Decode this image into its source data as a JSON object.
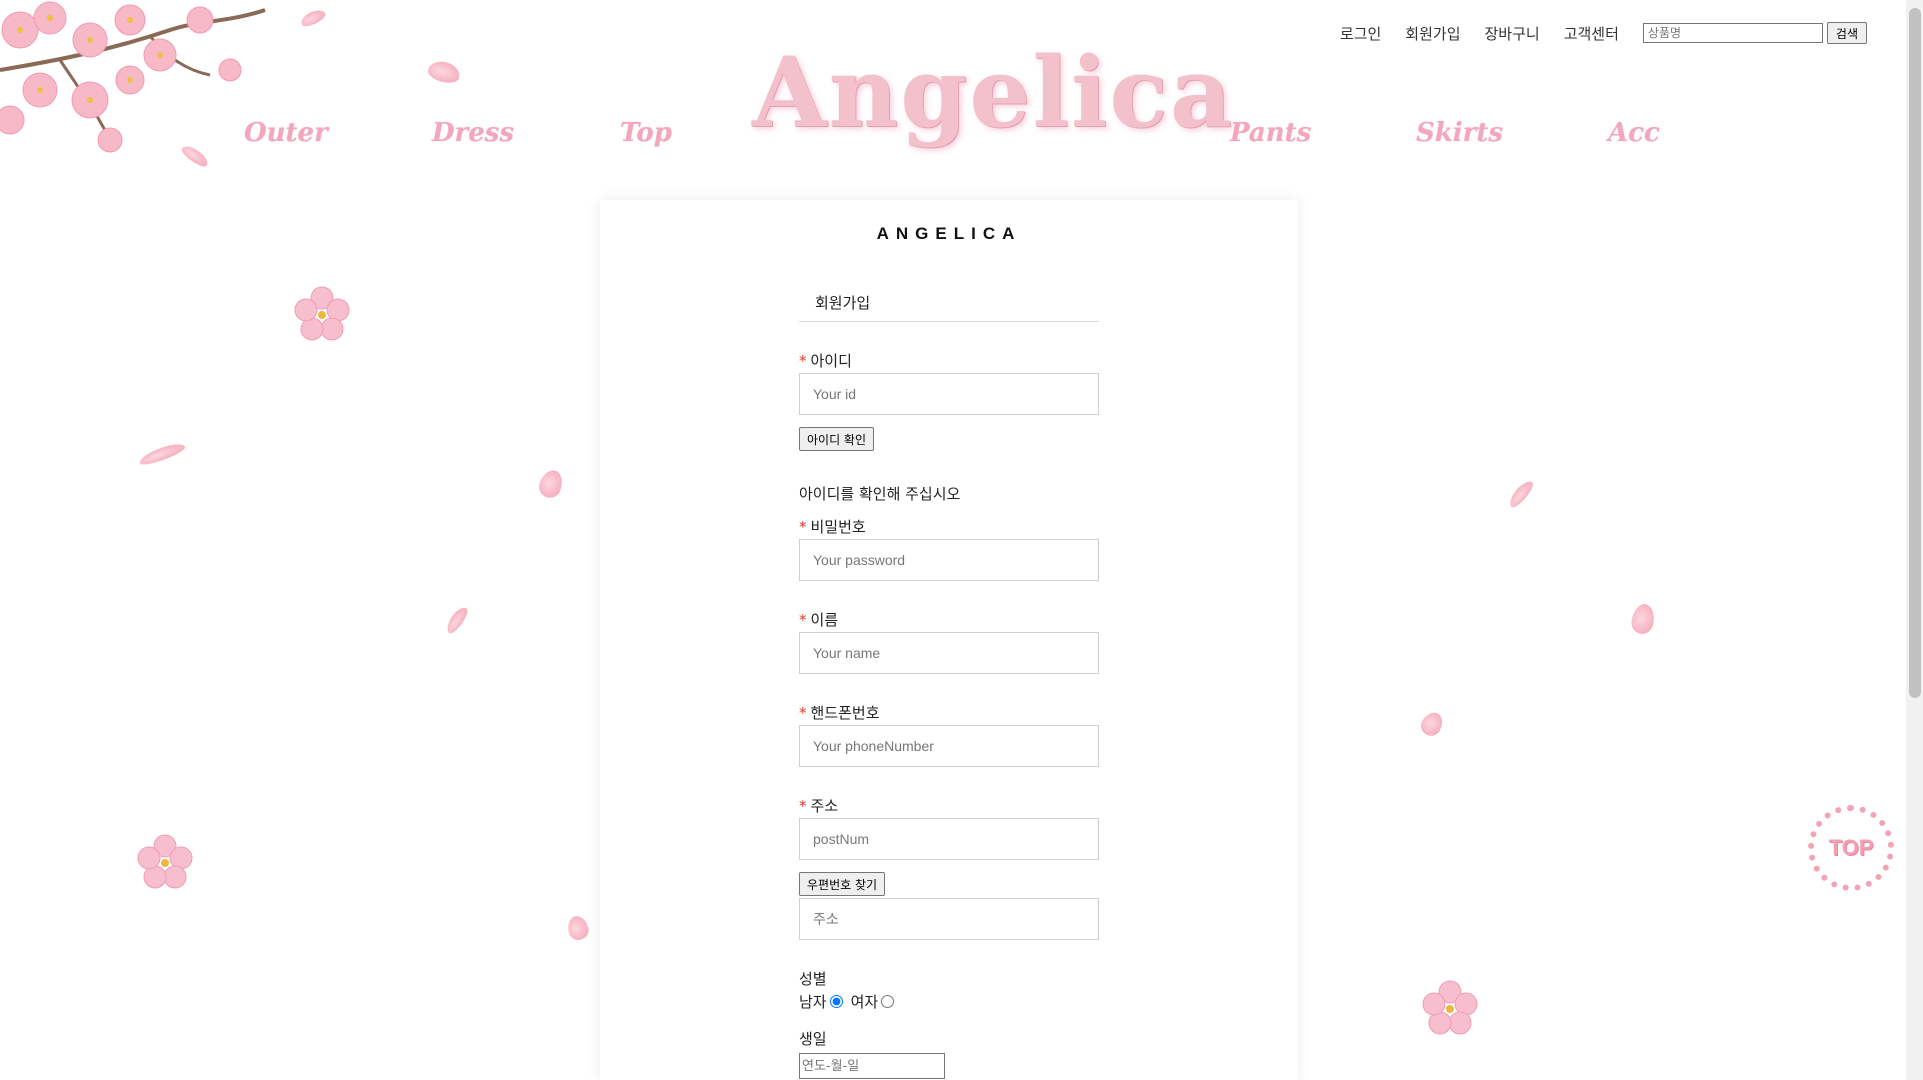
{
  "header": {
    "links": [
      "로그인",
      "회원가입",
      "장바구니",
      "고객센터"
    ],
    "search_placeholder": "상품명",
    "search_button": "검색",
    "logo_text": "Angelica"
  },
  "nav": [
    "Outer",
    "Dress",
    "Top",
    "Pants",
    "Skirts",
    "Acc"
  ],
  "brand": "ANGELICA",
  "form": {
    "title": "회원가입",
    "required_mark": "*",
    "id_label": "아이디",
    "id_placeholder": "Your id",
    "id_check_button": "아이디 확인",
    "id_helper": "아이디를 확인해 주십시오",
    "password_label": "비밀번호",
    "password_placeholder": "Your password",
    "name_label": "이름",
    "name_placeholder": "Your name",
    "phone_label": "핸드폰번호",
    "phone_placeholder": "Your phoneNumber",
    "address_label": "주소",
    "postnum_placeholder": "postNum",
    "postcode_button": "우편번호 찾기",
    "address_placeholder": "주소",
    "gender_label": "성별",
    "gender_male": "남자",
    "gender_female": "여자",
    "gender_selected": "남자",
    "birthday_label": "생일",
    "birthday_placeholder": "연도-월-일"
  },
  "top_button": "TOP",
  "colors": {
    "accent_pink": "#f2a7bd",
    "required_red": "#e0392b"
  }
}
